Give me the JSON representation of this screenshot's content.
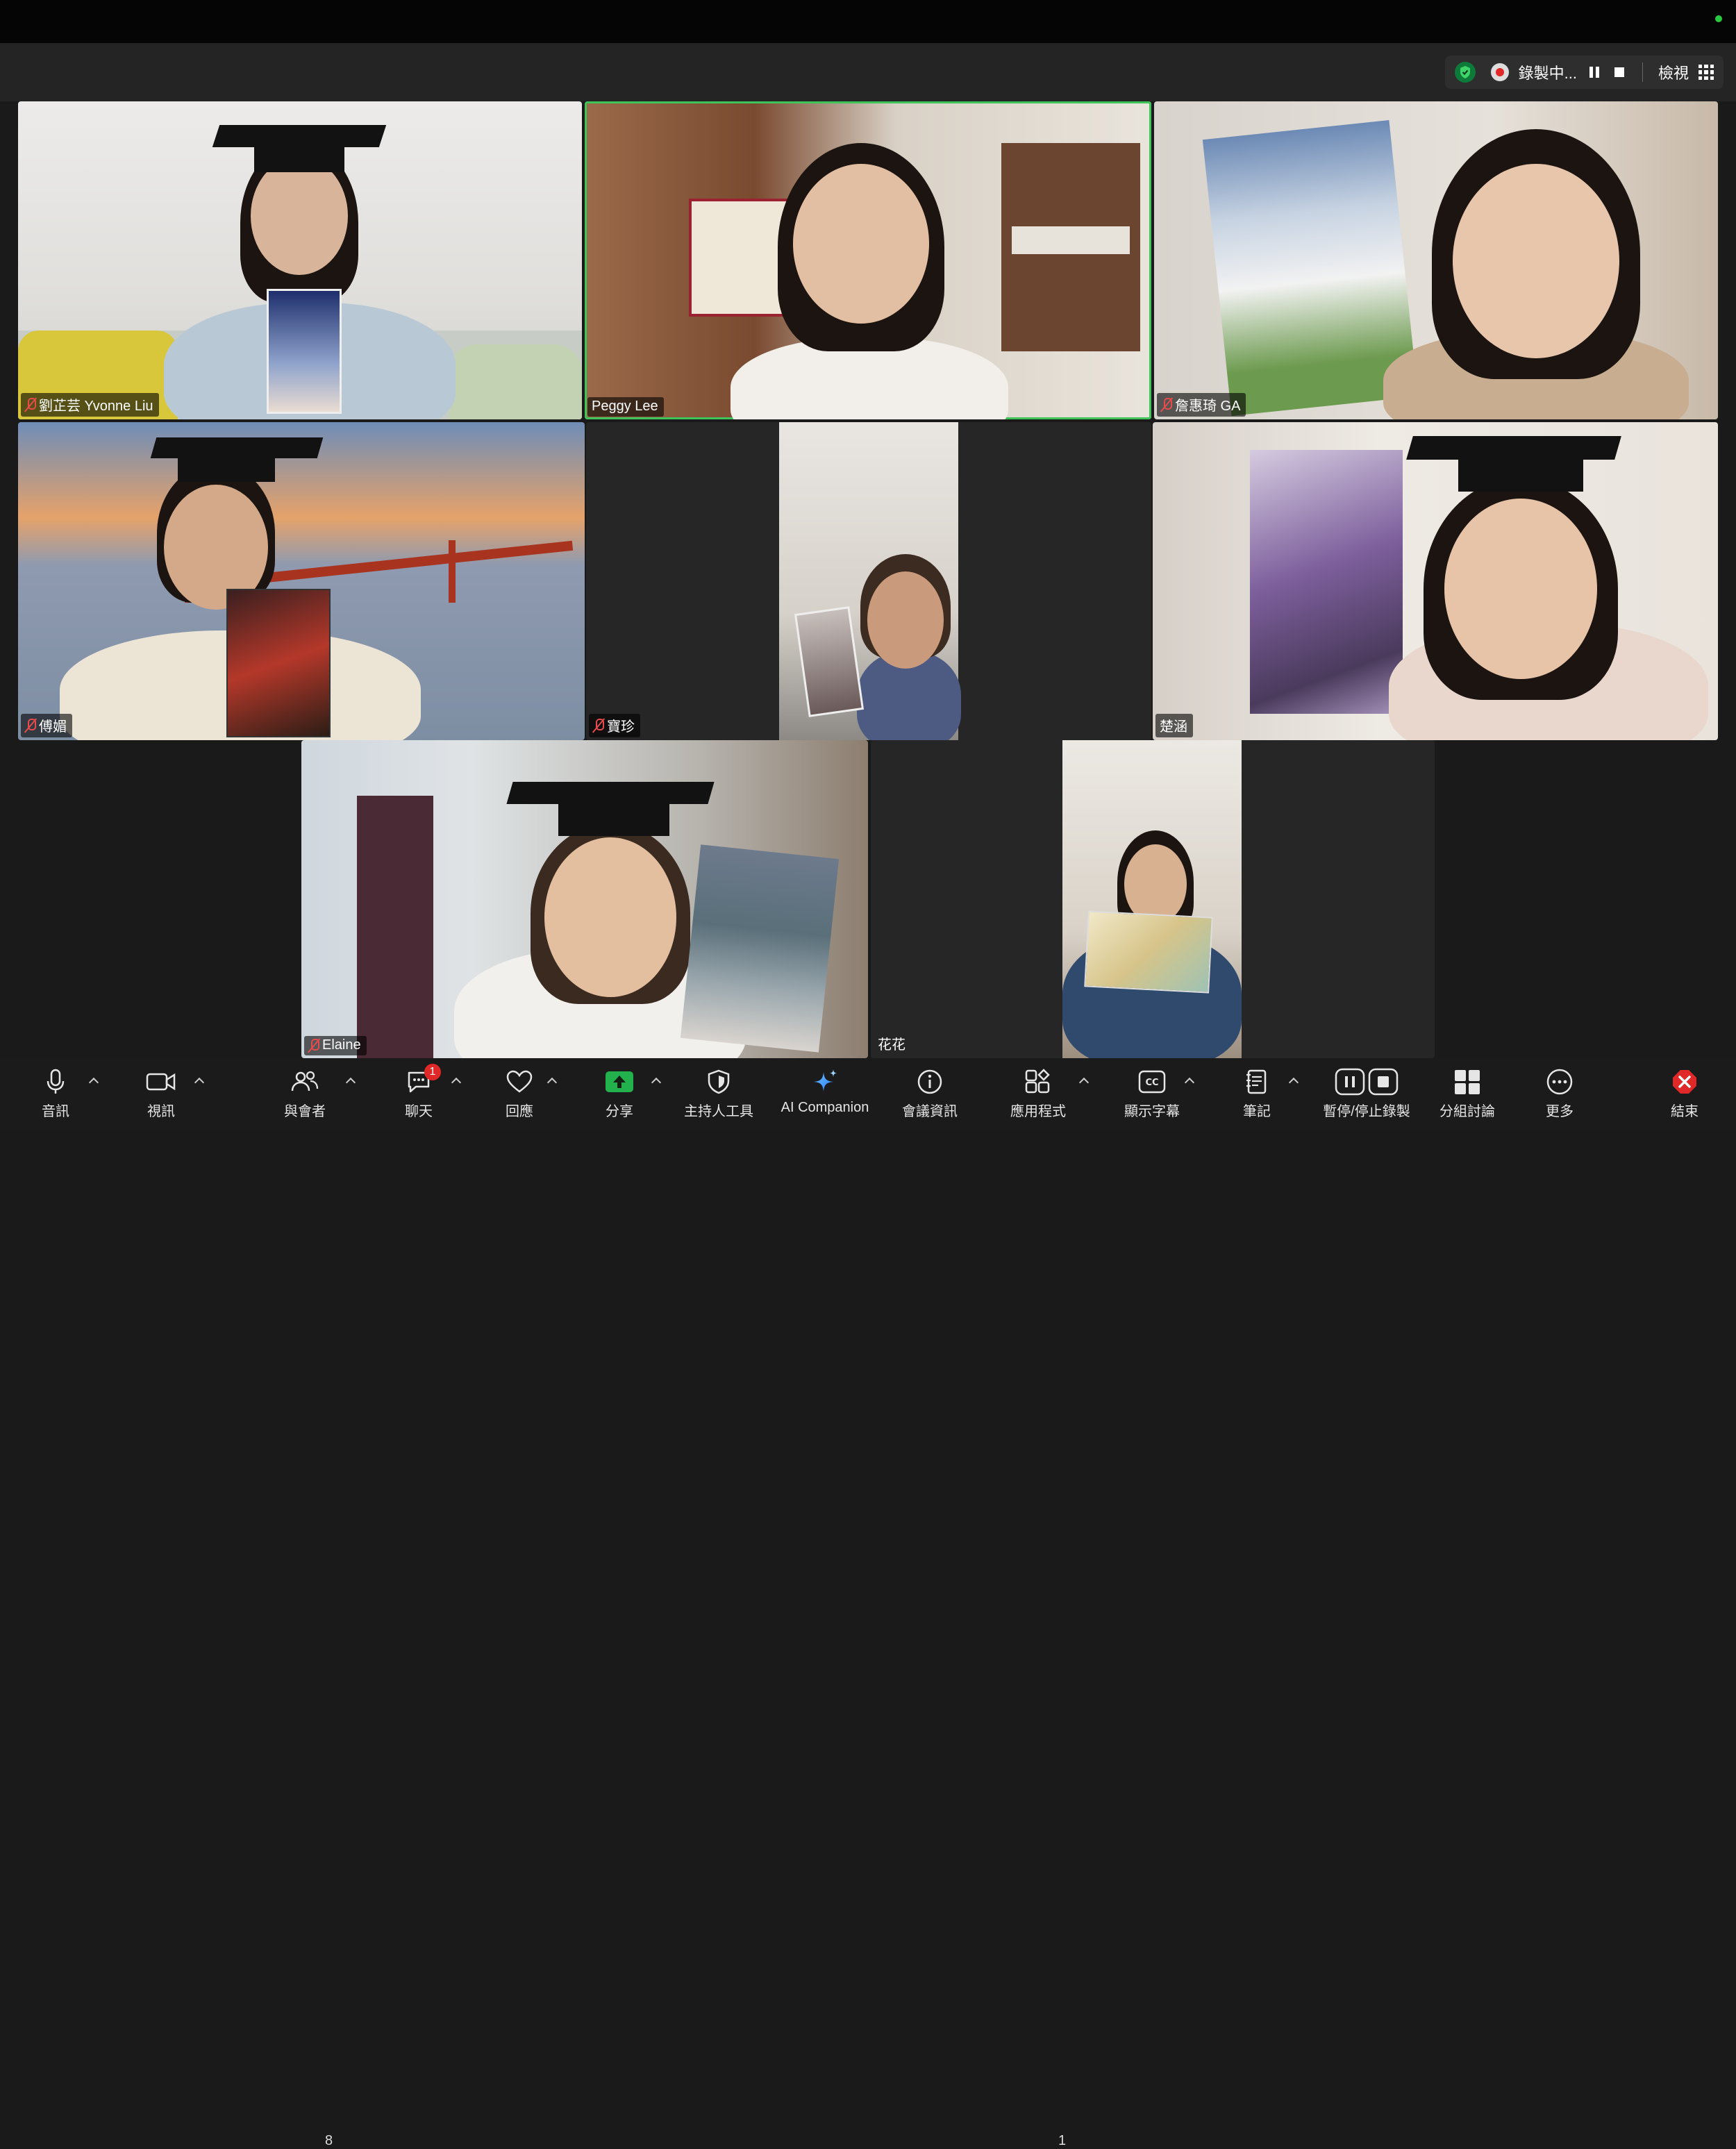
{
  "topbar": {
    "recording_text": "錄製中...",
    "view_label": "檢視"
  },
  "participants": [
    {
      "name": "劉芷芸 Yvonne Liu",
      "muted": true
    },
    {
      "name": "Peggy Lee",
      "muted": false,
      "active_speaker": true
    },
    {
      "name": "詹惠琦 GA",
      "muted": true
    },
    {
      "name": "傅媚",
      "muted": true
    },
    {
      "name": "寶珍",
      "muted": true
    },
    {
      "name": "楚涵",
      "muted": false
    },
    {
      "name": "Elaine",
      "muted": true
    },
    {
      "name": "花花",
      "muted": false
    }
  ],
  "toolbar": {
    "audio": "音訊",
    "video": "視訊",
    "participants": "與會者",
    "participants_count": "8",
    "chat": "聊天",
    "chat_badge": "1",
    "reactions": "回應",
    "share": "分享",
    "host_tools": "主持人工具",
    "ai_companion": "AI Companion",
    "meeting_info": "會議資訊",
    "apps": "應用程式",
    "apps_count": "1",
    "captions": "顯示字幕",
    "notes": "筆記",
    "record": "暫停/停止錄製",
    "breakout": "分組討論",
    "more": "更多",
    "end": "結束"
  },
  "colors": {
    "active_border": "#3fc45a",
    "share_green": "#22b14c",
    "end_red": "#e02828",
    "mute_red": "#e84b4b"
  }
}
